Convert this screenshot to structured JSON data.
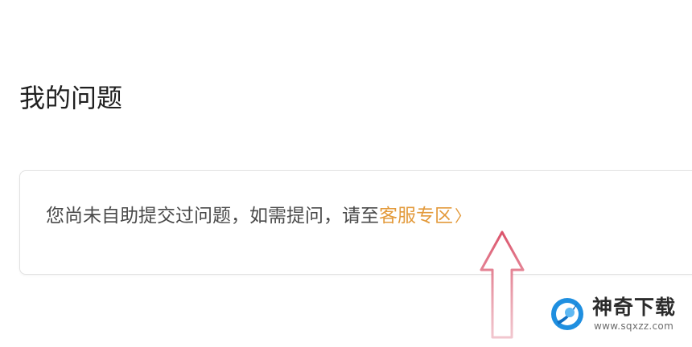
{
  "page": {
    "title": "我的问题"
  },
  "empty_state": {
    "message": "您尚未自助提交过问题，如需提问，请至",
    "link_label": "客服专区",
    "link_chevron": "〉",
    "link_color": "#e39a3b"
  },
  "annotation": {
    "arrow_color": "#d94a63"
  },
  "watermark": {
    "title": "神奇下载",
    "url": "www.sqxzz.com"
  }
}
